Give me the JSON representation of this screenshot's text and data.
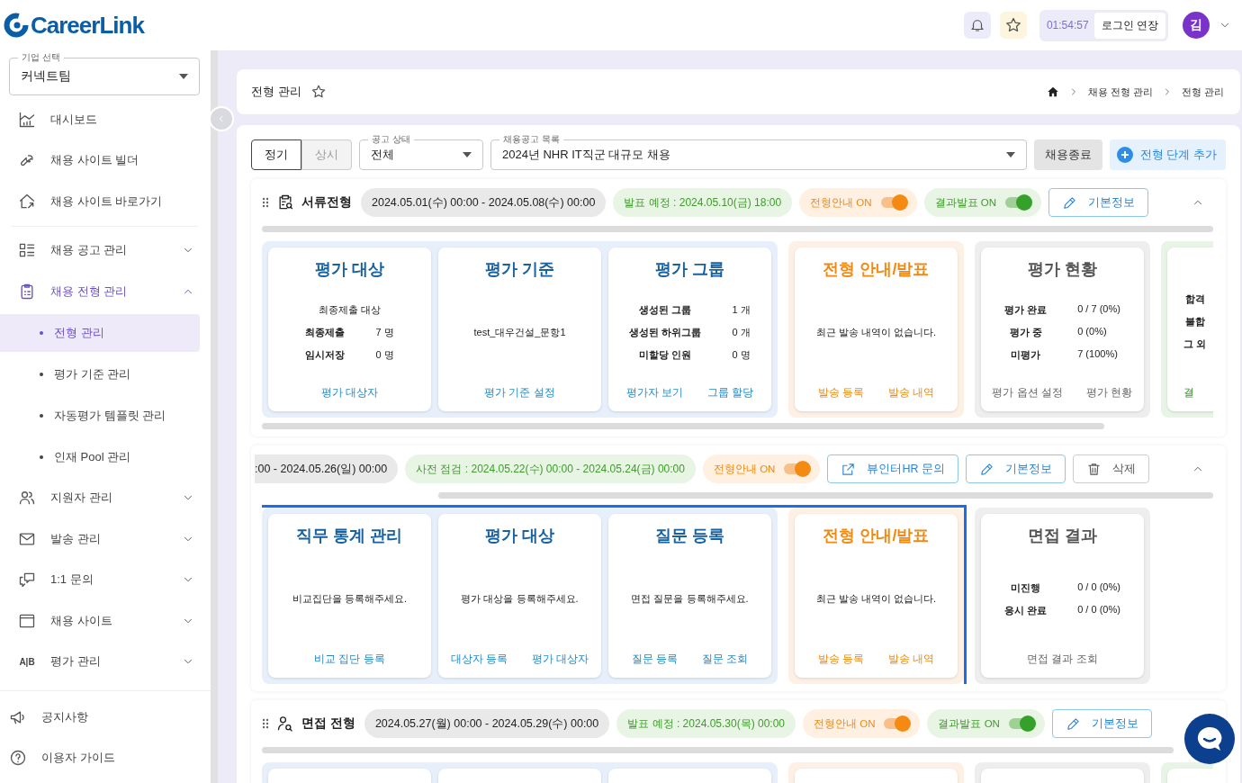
{
  "logo": {
    "text": "CareerLink"
  },
  "topbar": {
    "timer": "01:54:57",
    "extend_button": "로그인 연장",
    "avatar": "김"
  },
  "sidebar": {
    "company": {
      "legend": "기업 선택",
      "value": "커넥트팀"
    },
    "items": [
      {
        "label": "대시보드",
        "selected": false
      },
      {
        "label": "채용 사이트 빌더",
        "selected": false
      },
      {
        "label": "채용 사이트 바로가기",
        "selected": false
      },
      {
        "label": "채용 공고 관리",
        "expanded": false,
        "selected": false
      },
      {
        "label": "채용 전형 관리",
        "expanded": true,
        "selected": true,
        "children": [
          {
            "label": "전형 관리",
            "selected": true
          },
          {
            "label": "평가 기준 관리",
            "selected": false
          },
          {
            "label": "자동평가 템플릿 관리",
            "selected": false
          },
          {
            "label": "인재 Pool 관리",
            "selected": false
          }
        ]
      },
      {
        "label": "지원자 관리",
        "expanded": false,
        "selected": false
      },
      {
        "label": "발송 관리",
        "expanded": false,
        "selected": false
      },
      {
        "label": "1:1 문의",
        "expanded": false,
        "selected": false
      },
      {
        "label": "채용 사이트",
        "expanded": false,
        "selected": false
      },
      {
        "label": "평가 관리",
        "icon_text": "A|B",
        "expanded": false,
        "selected": false
      }
    ],
    "footer": [
      {
        "label": "공지사항"
      },
      {
        "label": "이용자 가이드"
      }
    ]
  },
  "page": {
    "title": "전형 관리",
    "breadcrumb": [
      "채용 전형 관리",
      "전형 관리"
    ]
  },
  "filters": {
    "types": [
      {
        "label": "정기",
        "selected": true
      },
      {
        "label": "상시",
        "selected": false
      }
    ],
    "status": {
      "legend": "공고 상태",
      "value": "전체"
    },
    "posting": {
      "legend": "채용공고 목록",
      "value": "2024년 NHR IT직군 대규모 채용"
    },
    "close_button": "채용종료",
    "add_button": "전형 단계 추가"
  },
  "sections": [
    {
      "title": "서류전형",
      "scrolled": false,
      "period": "2024.05.01(수) 00:00 - 2024.05.08(수) 00:00",
      "notice": "발표 예정 : 2024.05.10(금) 18:00",
      "toggles": [
        {
          "kind": "guide",
          "label": "전형안내 ON",
          "on": true
        },
        {
          "kind": "result",
          "label": "결과발표 ON",
          "on": true
        }
      ],
      "buttons": [
        {
          "kind": "edit",
          "label": "기본정보"
        }
      ],
      "expanded": true,
      "blocks": [
        {
          "selected": false,
          "groups": [
            {
              "kind": "blue",
              "cards": [
                {
                  "kind": "full",
                  "title": "평가 대상",
                  "subtitle": "최종제출 대상",
                  "rows": [
                    {
                      "label": "최종제출",
                      "value": "7 명"
                    },
                    {
                      "label": "임시저장",
                      "value": "0 명"
                    }
                  ],
                  "links": [
                    "평가 대상자"
                  ]
                },
                {
                  "kind": "full",
                  "title": "평가 기준",
                  "body": "test_대우건설_문항1",
                  "links": [
                    "평가 기준 설정"
                  ]
                },
                {
                  "kind": "full",
                  "title": "평가 그룹",
                  "rows": [
                    {
                      "label": "생성된 그룹",
                      "value": "1 개"
                    },
                    {
                      "label": "생성된 하위그룹",
                      "value": "0 개"
                    },
                    {
                      "label": "미할당 인원",
                      "value": "0 명"
                    }
                  ],
                  "links": [
                    "평가자 보기",
                    "그룹 할당"
                  ]
                }
              ]
            },
            {
              "kind": "orange",
              "cards": [
                {
                  "kind": "full",
                  "title": "전형 안내/발표",
                  "body": "최근 발송 내역이 없습니다.",
                  "links": [
                    "발송 등록",
                    "발송 내역"
                  ]
                }
              ]
            },
            {
              "kind": "gray",
              "cards": [
                {
                  "kind": "full",
                  "title": "평가 현황",
                  "rows": [
                    {
                      "label": "평가 완료",
                      "value": "0 / 7 (0%)"
                    },
                    {
                      "label": "평가 중",
                      "value": "0 (0%)"
                    },
                    {
                      "label": "미평가",
                      "value": "7 (100%)"
                    }
                  ],
                  "links": [
                    "평가 옵션 설정",
                    "평가 현황"
                  ]
                }
              ]
            },
            {
              "kind": "green",
              "cards": [
                {
                  "kind": "full",
                  "rows": [
                    {
                      "label": "합격"
                    },
                    {
                      "label": "불합"
                    },
                    {
                      "label": "그 외"
                    }
                  ],
                  "links": [
                    "결"
                  ]
                }
              ]
            }
          ]
        }
      ]
    },
    {
      "scrolled": true,
      "period": ":00 - 2024.05.26(일) 00:00",
      "notice": "사전 점검 : 2024.05.22(수) 00:00 - 2024.05.24(금) 00:00",
      "toggles": [
        {
          "kind": "guide",
          "label": "전형안내 ON",
          "on": true
        }
      ],
      "buttons": [
        {
          "kind": "external",
          "label": "뷰인터HR 문의"
        },
        {
          "kind": "edit",
          "label": "기본정보"
        },
        {
          "kind": "delete",
          "label": "삭제"
        }
      ],
      "expanded": true,
      "blocks": [
        {
          "selected": true,
          "groups": [
            {
              "kind": "blue",
              "cards": [
                {
                  "kind": "full",
                  "title": "직무 통계 관리",
                  "body": "비교집단을 등록해주세요.",
                  "links": [
                    "비교 집단 등록"
                  ]
                },
                {
                  "kind": "full",
                  "title": "평가 대상",
                  "body": "평가 대상을 등록해주세요.",
                  "links": [
                    "대상자 등록",
                    "평가 대상자"
                  ]
                },
                {
                  "kind": "full",
                  "title": "질문 등록",
                  "body": "면접 질문을 등록해주세요.",
                  "links": [
                    "질문 등록",
                    "질문 조회"
                  ]
                }
              ]
            },
            {
              "kind": "orange",
              "cards": [
                {
                  "kind": "full",
                  "title": "전형 안내/발표",
                  "body": "최근 발송 내역이 없습니다.",
                  "links": [
                    "발송 등록",
                    "발송 내역"
                  ]
                }
              ]
            }
          ]
        },
        {
          "selected": false,
          "groups": [
            {
              "kind": "gray",
              "cards": [
                {
                  "kind": "full",
                  "title": "면접 결과",
                  "rows": [
                    {
                      "label": "미진행",
                      "value": "0 / 0 (0%)"
                    },
                    {
                      "label": "응시 완료",
                      "value": "0 / 0 (0%)"
                    }
                  ],
                  "links": [
                    "면접 결과 조회"
                  ]
                }
              ]
            }
          ]
        }
      ]
    },
    {
      "title": "면접 전형",
      "scrolled": false,
      "period": "2024.05.27(월) 00:00 - 2024.05.29(수) 00:00",
      "notice": "발표 예정 : 2024.05.30(목) 00:00",
      "toggles": [
        {
          "kind": "guide",
          "label": "전형안내 ON",
          "on": true
        },
        {
          "kind": "result",
          "label": "결과발표 ON",
          "on": true
        }
      ],
      "buttons": [
        {
          "kind": "edit",
          "label": "기본정보"
        }
      ],
      "expanded": true,
      "blocks": [
        {
          "selected": false,
          "groups": [
            {
              "kind": "blue",
              "cards": [
                {
                  "kind": "blank"
                },
                {
                  "kind": "blank"
                },
                {
                  "kind": "blank"
                }
              ]
            },
            {
              "kind": "orange",
              "cards": [
                {
                  "kind": "blank"
                }
              ]
            },
            {
              "kind": "gray",
              "cards": [
                {
                  "kind": "blank"
                }
              ]
            },
            {
              "kind": "green",
              "cards": [
                {
                  "kind": "blank"
                }
              ]
            }
          ]
        }
      ]
    }
  ]
}
